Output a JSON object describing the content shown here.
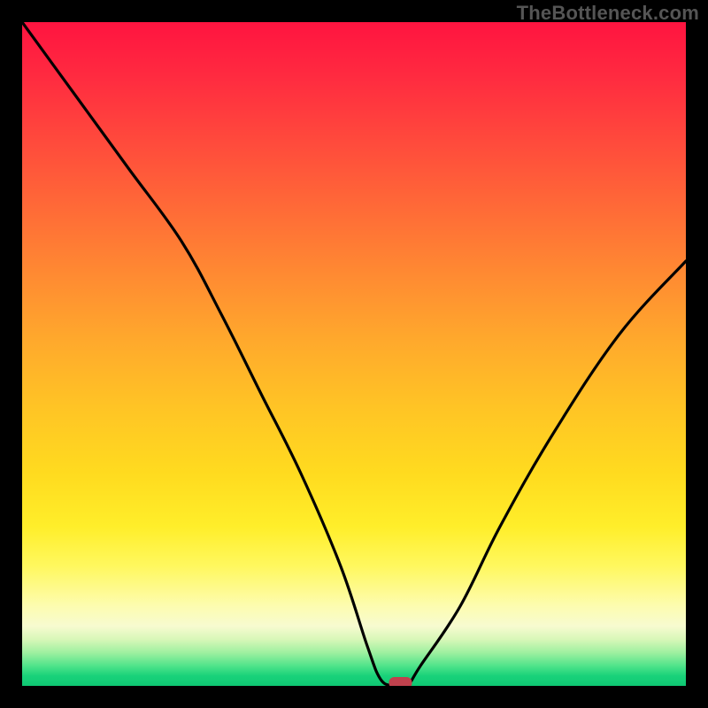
{
  "watermark": "TheBottleneck.com",
  "chart_data": {
    "type": "line",
    "title": "",
    "xlabel": "",
    "ylabel": "",
    "xlim": [
      0,
      100
    ],
    "ylim": [
      0,
      100
    ],
    "grid": false,
    "legend": false,
    "series": [
      {
        "name": "bottleneck-curve",
        "x": [
          0,
          8,
          16,
          24,
          30,
          36,
          42,
          48,
          52,
          54,
          56,
          58,
          60,
          66,
          72,
          80,
          90,
          100
        ],
        "values": [
          100,
          89,
          78,
          67,
          56,
          44,
          32,
          18,
          6,
          1,
          0,
          0,
          3,
          12,
          24,
          38,
          53,
          64
        ]
      }
    ],
    "annotations": [
      {
        "name": "valley-marker",
        "x": 57,
        "y": 0
      }
    ],
    "background_gradient": {
      "stops": [
        {
          "pos": 0.0,
          "color": "#ff1440"
        },
        {
          "pos": 0.5,
          "color": "#ffa92c"
        },
        {
          "pos": 0.82,
          "color": "#fff85f"
        },
        {
          "pos": 0.92,
          "color": "#f7fbd0"
        },
        {
          "pos": 1.0,
          "color": "#0fc873"
        }
      ]
    }
  }
}
